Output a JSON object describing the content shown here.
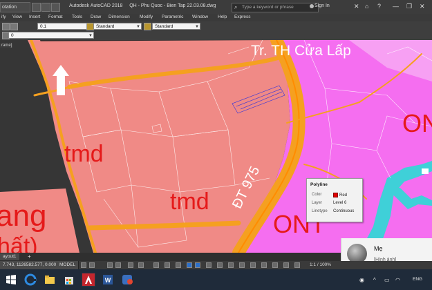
{
  "titlebar": {
    "workspace": "otation",
    "app_title": "Autodesk AutoCAD 2018",
    "file_title": "QH - Phu Quoc - Bien Tap 22.03.08.dwg",
    "search_placeholder": "Type a keyword or phrase",
    "signin_label": "Sign In"
  },
  "menubar": {
    "items": [
      "ify",
      "View",
      "Insert",
      "Format",
      "Tools",
      "Draw",
      "Dimension",
      "Modify",
      "Parametric",
      "Window",
      "Help",
      "Express"
    ]
  },
  "toolbar": {
    "lineweight": "0.1",
    "text_style": "Standard",
    "dim_style": "Standard",
    "layer": "0"
  },
  "viewport_label": "rame]",
  "drawing_labels": {
    "school": "Tr. TH Cửa Lấp",
    "zone_tmd_1": "tmd",
    "zone_tmd_2": "tmd",
    "zone_ont_1": "ONT",
    "zone_ont_2": "ONT",
    "road_name": "ĐT 975",
    "partial_left_1": "ang",
    "partial_left_2": "hất)"
  },
  "tooltip": {
    "title": "Polyline",
    "rows": [
      {
        "key": "Color",
        "value": "Red"
      },
      {
        "key": "Layer",
        "value": "Level 6"
      },
      {
        "key": "Linetype",
        "value": "Continuous"
      }
    ]
  },
  "notification": {
    "sender": "Mẹ",
    "message": "[Hình ảnh]"
  },
  "layout_tab": "ayout1",
  "statusbar": {
    "coords": "7.743, 1126582.577, 0.000",
    "model_label": "MODEL",
    "scale": "1:1 / 100%"
  },
  "taskbar": {
    "language": "ENG"
  },
  "colors": {
    "pink_zone": "#f08a86",
    "magenta_zone": "#f56ef0",
    "road_orange": "#f5a020",
    "water_cyan": "#3fd0d8",
    "label_red": "#e51a1a",
    "school_label": "#ffffff"
  }
}
